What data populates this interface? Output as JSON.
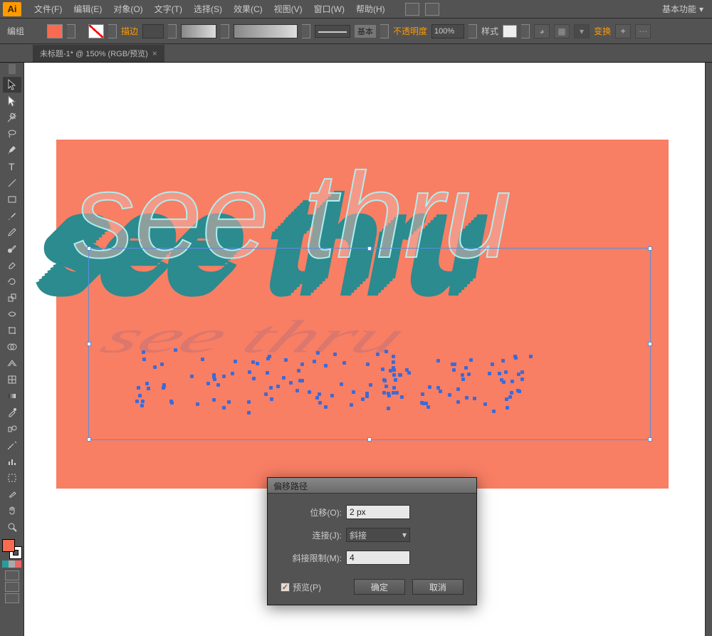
{
  "app": {
    "logo": "Ai"
  },
  "menu": {
    "items": [
      "文件(F)",
      "编辑(E)",
      "对象(O)",
      "文字(T)",
      "选择(S)",
      "效果(C)",
      "视图(V)",
      "窗口(W)",
      "帮助(H)"
    ]
  },
  "workspace": {
    "label": "基本功能"
  },
  "controlbar": {
    "context_label": "编组",
    "stroke_label": "描边",
    "stroke_weight": "",
    "brush_label": "基本",
    "opacity_label": "不透明度",
    "opacity_value": "100%",
    "style_label": "样式",
    "transform_label": "变换"
  },
  "doc_tab": {
    "title": "未标题-1* @ 150% (RGB/预览)",
    "close": "×"
  },
  "artwork": {
    "text": "see thru"
  },
  "dialog": {
    "title": "偏移路径",
    "offset_label": "位移(O):",
    "offset_value": "2 px",
    "join_label": "连接(J):",
    "join_value": "斜接",
    "miter_label": "斜接限制(M):",
    "miter_value": "4",
    "preview_label": "预览(P)",
    "ok": "确定",
    "cancel": "取消"
  },
  "tools": [
    "selection",
    "direct-selection",
    "magic-wand",
    "lasso",
    "pen",
    "type",
    "line",
    "rectangle",
    "paintbrush",
    "pencil",
    "blob",
    "eraser",
    "rotate",
    "scale",
    "width",
    "free-transform",
    "shape-builder",
    "perspective",
    "mesh",
    "gradient",
    "eyedropper",
    "blend",
    "symbol-spray",
    "graph",
    "artboard",
    "slice",
    "hand",
    "zoom"
  ],
  "colors": {
    "fill": "#f76b51",
    "artboard": "#f87e64",
    "teal": "#2b8b8f"
  }
}
